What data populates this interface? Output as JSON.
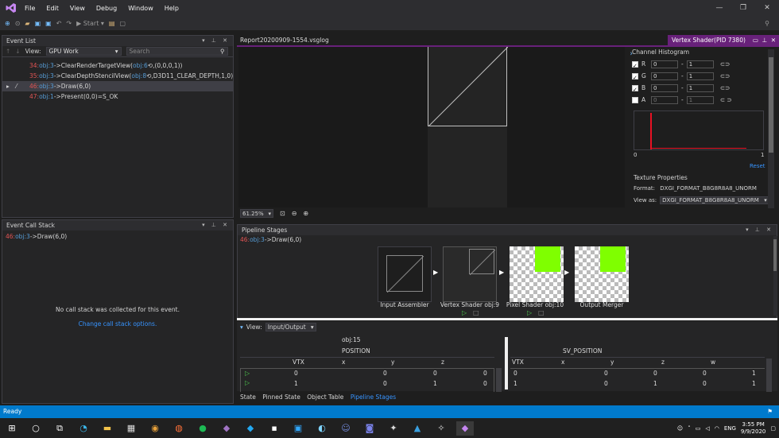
{
  "menu": [
    "File",
    "Edit",
    "View",
    "Debug",
    "Window",
    "Help"
  ],
  "toolbar": {
    "start_label": "Start"
  },
  "event_list": {
    "title": "Event List",
    "view_label": "View:",
    "view_value": "GPU Work",
    "search_placeholder": "Search",
    "rows": [
      {
        "num": "34:",
        "obj": "obj:3",
        "text": "->ClearRenderTargetView(",
        "obj2": "obj:6",
        "text2": ",(0,0,0,1))"
      },
      {
        "num": "35:",
        "obj": "obj:3",
        "text": "->ClearDepthStencilView(",
        "obj2": "obj:8",
        "text2": ",D3D11_CLEAR_DEPTH,1,0)"
      },
      {
        "num": "46:",
        "obj": "obj:3",
        "text": "->Draw(6,0)",
        "obj2": "",
        "text2": ""
      },
      {
        "num": "47:",
        "obj": "obj:1",
        "text": "->Present(0,0)=S_OK",
        "obj2": "",
        "text2": ""
      }
    ]
  },
  "call_stack": {
    "title": "Event Call Stack",
    "entry_num": "46:",
    "entry_obj": "obj:3",
    "entry_text": "->Draw(6,0)",
    "message": "No call stack was collected for this event.",
    "link": "Change call stack options."
  },
  "document": {
    "tab_label": "Report20200909-1554.vsglog",
    "vs_tab_label": "Vertex Shader(PID 7380)",
    "zoom": "61.25%"
  },
  "channel_histogram": {
    "title": "Channel Histogram",
    "channels": [
      {
        "label": "R",
        "checked": true,
        "min": "0",
        "max": "1"
      },
      {
        "label": "G",
        "checked": true,
        "min": "0",
        "max": "1"
      },
      {
        "label": "B",
        "checked": true,
        "min": "0",
        "max": "1"
      },
      {
        "label": "A",
        "checked": false,
        "min": "0",
        "max": "1"
      }
    ],
    "axis_min": "0",
    "axis_max": "1",
    "reset": "Reset"
  },
  "texture_properties": {
    "title": "Texture Properties",
    "format_label": "Format:",
    "format_value": "DXGI_FORMAT_B8G8R8A8_UNORM",
    "viewas_label": "View as:",
    "viewas_value": "DXGI_FORMAT_B8G8R8A8_UNORM"
  },
  "pipeline": {
    "title": "Pipeline Stages",
    "entry_num": "46:",
    "entry_obj": "obj:3",
    "entry_text": "->Draw(6,0)",
    "stages": [
      {
        "label": "Input Assembler"
      },
      {
        "label": "Vertex Shader obj:9"
      },
      {
        "label": "Pixel Shader obj:10"
      },
      {
        "label": "Output Merger"
      }
    ],
    "accent_green": "#7fff00"
  },
  "io": {
    "view_label": "View:",
    "view_value": "Input/Output",
    "left": {
      "obj": "obj:15",
      "semantic": "POSITION",
      "headers": [
        "VTX",
        "x",
        "y",
        "z"
      ],
      "rows": [
        [
          "0",
          "0",
          "0",
          "0"
        ],
        [
          "1",
          "0",
          "1",
          "0"
        ]
      ]
    },
    "right": {
      "semantic": "SV_POSITION",
      "headers": [
        "VTX",
        "x",
        "y",
        "z",
        "w"
      ],
      "rows": [
        [
          "0",
          "0",
          "0",
          "0",
          "1"
        ],
        [
          "1",
          "0",
          "1",
          "0",
          "1"
        ]
      ]
    }
  },
  "bottom_tabs": [
    "State",
    "Pinned State",
    "Object Table",
    "Pipeline Stages"
  ],
  "status": "Ready",
  "taskbar": {
    "lang": "ENG",
    "time": "3:55 PM",
    "date": "9/9/2020"
  }
}
